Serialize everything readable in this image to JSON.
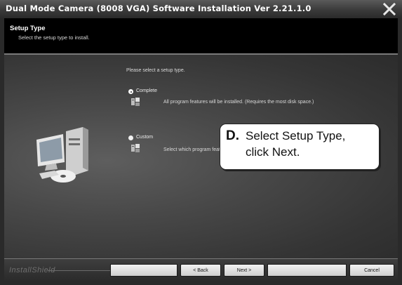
{
  "window": {
    "title": "Dual Mode Camera (8008 VGA) Software Installation Ver 2.21.1.0"
  },
  "header": {
    "title": "Setup Type",
    "subtitle": "Select the setup type to install."
  },
  "main": {
    "prompt": "Please select a setup type.",
    "options": [
      {
        "label": "Complete",
        "description": "All program features will be installed. (Requires the most disk space.)",
        "selected": true
      },
      {
        "label": "Custom",
        "description": "Select which program features you want installed. Recommended for advanced users.",
        "selected": false
      }
    ]
  },
  "callout": {
    "letter": "D.",
    "line1": "Select Setup Type,",
    "line2_text": "click Next."
  },
  "footer": {
    "brand": "InstallShield",
    "back_label": "< Back",
    "next_label": "Next >",
    "cancel_label": "Cancel"
  },
  "icons": {
    "close": "close-icon",
    "computer": "computer-icon",
    "install": "install-icon"
  }
}
